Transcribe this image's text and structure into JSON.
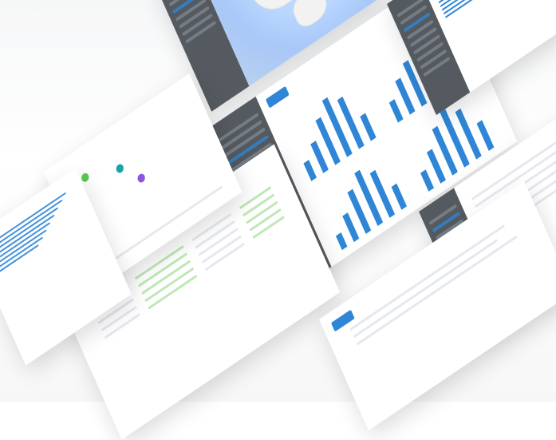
{
  "scene": {
    "cards": [
      {
        "id": "map",
        "brand": "",
        "nav_items": 7,
        "active_nav_index": 2,
        "map_markers": 2
      },
      {
        "id": "charts",
        "brand": "",
        "nav_items": 8,
        "active_nav_index": 3,
        "button_label": "",
        "subcharts": 4
      },
      {
        "id": "table_green",
        "button_label": "",
        "pagination": ""
      },
      {
        "id": "analytics_list",
        "brand": "",
        "nav_items": 9,
        "active_nav_index": 2
      },
      {
        "id": "left_barlist",
        "brand": ""
      },
      {
        "id": "right_table",
        "brand": ""
      },
      {
        "id": "bottom_table",
        "button_label": ""
      }
    ]
  },
  "colors": {
    "sidebar": "#555a60",
    "primary": "#2f86d6",
    "table_highlight": "#bfe8b6",
    "map_water": "#b9d7ff"
  }
}
